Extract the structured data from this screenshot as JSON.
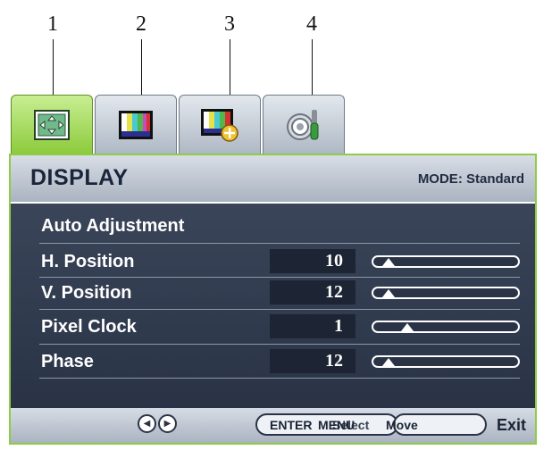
{
  "callouts": [
    "1",
    "2",
    "3",
    "4"
  ],
  "tabs": [
    {
      "icon": "display-settings-icon",
      "active": true
    },
    {
      "icon": "picture-color-bars-icon",
      "active": false
    },
    {
      "icon": "picture-advanced-icon",
      "active": false
    },
    {
      "icon": "system-settings-icon",
      "active": false
    }
  ],
  "header": {
    "title": "DISPLAY",
    "mode": "MODE: Standard"
  },
  "rows": [
    {
      "label": "Auto Adjustment"
    },
    {
      "label": "H. Position",
      "value": "10",
      "slider_fraction": 0.05
    },
    {
      "label": "V. Position",
      "value": "12",
      "slider_fraction": 0.05
    },
    {
      "label": "Pixel Clock",
      "value": "1",
      "slider_fraction": 0.2
    },
    {
      "label": "Phase",
      "value": "12",
      "slider_fraction": 0.05
    }
  ],
  "footer": {
    "enter": "ENTER",
    "menu": "MENU",
    "select": "Select",
    "move": "Move",
    "exit": "Exit"
  },
  "colors": {
    "active_tab": "#8dcb3d",
    "panel": "#2e3749",
    "accent": "#8fcc45"
  }
}
